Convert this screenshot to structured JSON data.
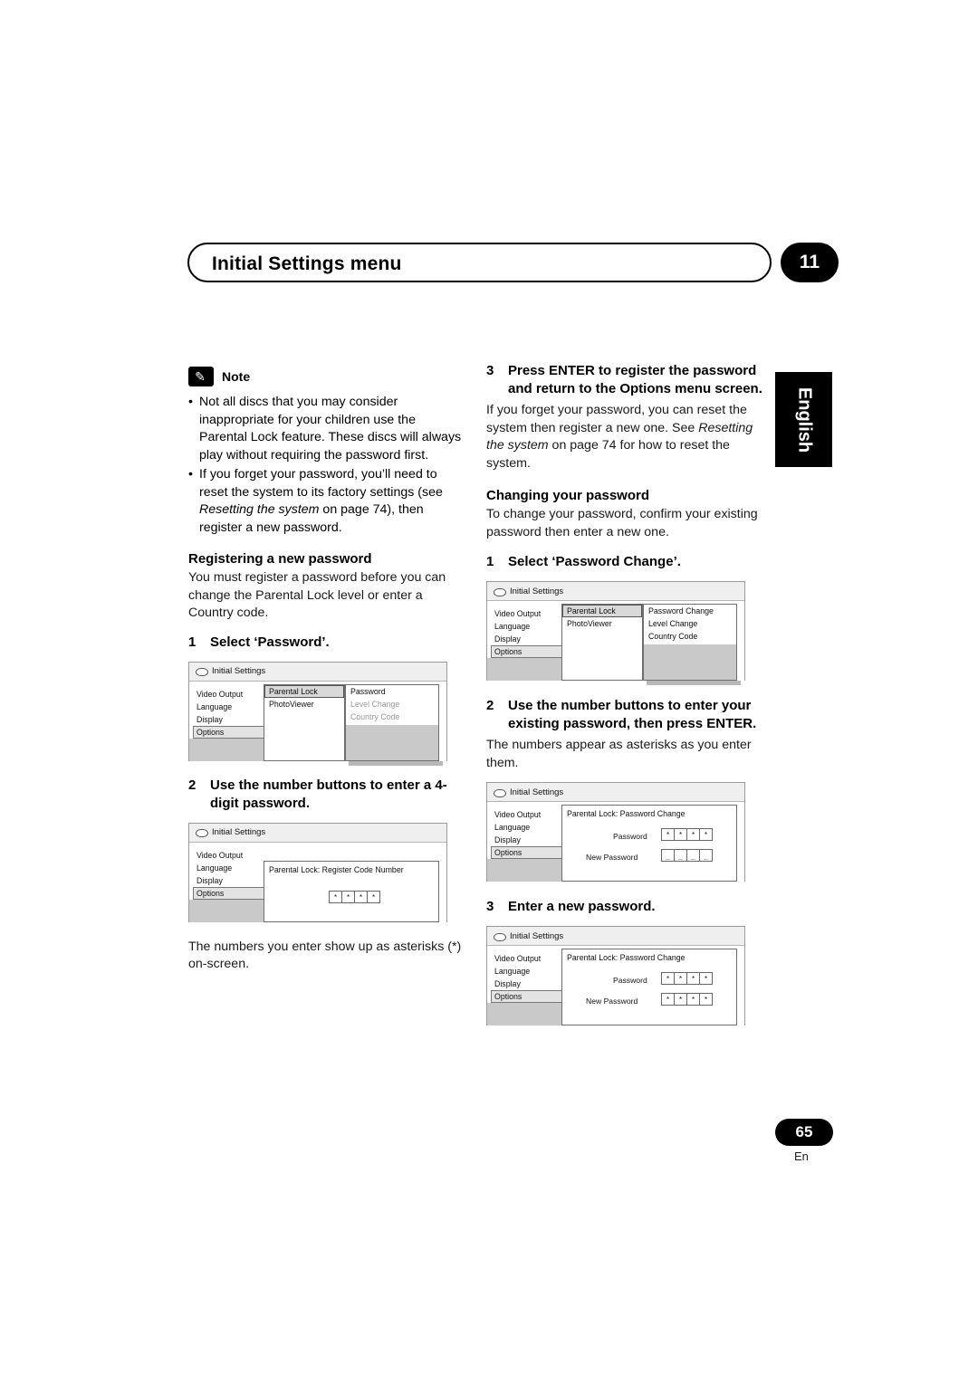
{
  "header": {
    "title": "Initial Settings menu",
    "chapter": "11"
  },
  "language_tab": "English",
  "note": {
    "label": "Note",
    "bullets": [
      "Not all discs that you may consider inappropriate for your children use the Parental Lock feature. These discs will always play without requiring the password first.",
      "If you forget your password, you’ll need to reset the system to its factory settings (see Resetting the system on page 74), then register a new password."
    ]
  },
  "left": {
    "registering_heading": "Registering a new password",
    "registering_text": "You must register a password before you can change the Parental Lock level or enter a Country code.",
    "step1_num": "1",
    "step1_text": "Select ‘Password’.",
    "step2_num": "2",
    "step2_text": "Use the number buttons to enter a 4-digit password.",
    "asterisk_text": "The numbers you enter show up as asterisks (*) on-screen."
  },
  "right": {
    "step3_num": "3",
    "step3_text": "Press ENTER to register the password and return to the Options menu screen.",
    "step3_body_a": "If you forget your password, you can reset the system then register a new one. See ",
    "step3_body_italic": "Resetting the system",
    "step3_body_b": " on page 74 for how to reset the system.",
    "changing_heading": "Changing your password",
    "changing_text": "To change your password, confirm your existing password then enter a new one.",
    "step1_num": "1",
    "step1_text": "Select ‘Password Change’.",
    "step2_num": "2",
    "step2_text": "Use the number buttons to enter your existing password, then press ENTER.",
    "step2_body": "The numbers appear as asterisks as you enter them.",
    "step3b_num": "3",
    "step3b_text": "Enter a new password."
  },
  "osd": {
    "title": "Initial Settings",
    "menu": [
      "Video Output",
      "Language",
      "Display",
      "Options"
    ],
    "figure1": {
      "col2": [
        "Parental Lock",
        "PhotoViewer"
      ],
      "col3": [
        "Password",
        "Level Change",
        "Country Code"
      ]
    },
    "figure2": {
      "panel_title": "Parental Lock: Register Code Number",
      "stars": [
        "*",
        "*",
        "*",
        "*"
      ]
    },
    "figure3": {
      "col2": [
        "Parental Lock",
        "PhotoViewer"
      ],
      "col3": [
        "Password Change",
        "Level Change",
        "Country Code"
      ]
    },
    "figure4": {
      "panel_title": "Parental Lock: Password Change",
      "password_label": "Password",
      "password_stars": [
        "*",
        "*",
        "*",
        "*"
      ],
      "new_password_label": "New Password",
      "new_password_stars": [
        "_",
        "_",
        "_",
        "_"
      ]
    },
    "figure5": {
      "panel_title": "Parental Lock: Password Change",
      "password_label": "Password",
      "password_stars": [
        "*",
        "*",
        "*",
        "*"
      ],
      "new_password_label": "New Password",
      "new_password_stars": [
        "*",
        "*",
        "*",
        "*"
      ]
    }
  },
  "footer": {
    "page": "65",
    "lang_code": "En"
  }
}
